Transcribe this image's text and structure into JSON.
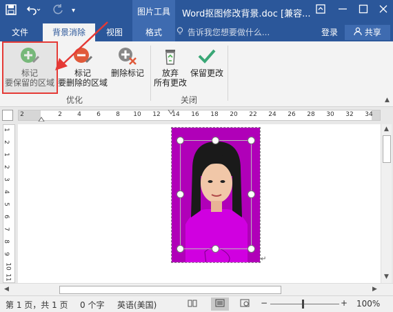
{
  "titlebar": {
    "save_icon": "save-icon",
    "undo_icon": "undo-icon",
    "redo_icon": "redo-icon",
    "context_tab": "图片工具",
    "doc_title": "Word抠图修改背景.doc [兼容...",
    "restore_icon": "ribbon-display-icon",
    "minimize_icon": "minimize-icon",
    "maximize_icon": "maximize-icon",
    "close_icon": "close-icon"
  },
  "tabs": [
    {
      "label": "文件"
    },
    {
      "label": "背景消除"
    },
    {
      "label": "视图"
    },
    {
      "label": "格式"
    }
  ],
  "tell_me": {
    "placeholder": "告诉我您想要做什么..."
  },
  "account": {
    "login": "登录",
    "share": "共享"
  },
  "ribbon": {
    "mark_keep": {
      "line1": "标记",
      "line2": "要保留的区域"
    },
    "mark_remove": {
      "line1": "标记",
      "line2": "要删除的区域"
    },
    "delete_mark": {
      "label": "删除标记"
    },
    "discard": {
      "line1": "放弃",
      "line2": "所有更改"
    },
    "keep_changes": {
      "label": "保留更改"
    },
    "group_refine": "优化",
    "group_close": "关闭"
  },
  "ruler": {
    "h_ticks": [
      "2",
      "2",
      "4",
      "6",
      "8",
      "10",
      "12",
      "14",
      "16",
      "18",
      "20",
      "22",
      "24",
      "26",
      "28",
      "30",
      "32",
      "34"
    ],
    "v_ticks": [
      "1",
      "2",
      "1",
      "2",
      "3",
      "4",
      "5",
      "6",
      "7",
      "8",
      "9",
      "10",
      "11"
    ]
  },
  "status": {
    "page": "第 1 页，共 1 页",
    "words": "0 个字",
    "language": "英语(美国)",
    "zoom": "100%",
    "zoom_minus": "−",
    "zoom_plus": "+"
  },
  "colors": {
    "brand": "#2b579a",
    "photo_background": "#b000b8",
    "annotation": "#e53935"
  }
}
